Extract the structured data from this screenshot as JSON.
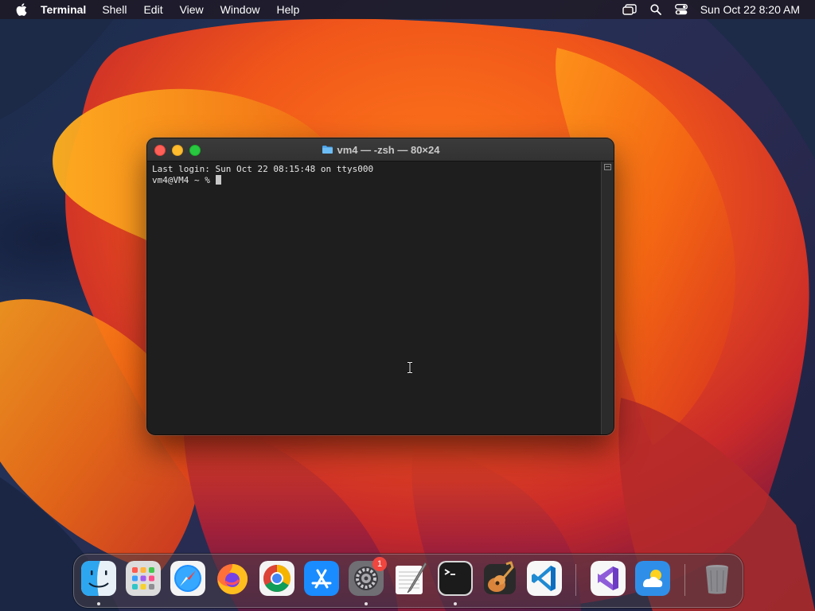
{
  "menubar": {
    "app_name": "Terminal",
    "items": [
      "Shell",
      "Edit",
      "View",
      "Window",
      "Help"
    ],
    "clock": "Sun Oct 22  8:20 AM"
  },
  "window": {
    "title": "vm4 — -zsh — 80×24",
    "lines": [
      "Last login: Sun Oct 22 08:15:48 on ttys000",
      "vm4@VM4 ~ % "
    ]
  },
  "dock": {
    "apps": [
      {
        "name": "Finder",
        "icon": "finder-icon",
        "running": true
      },
      {
        "name": "Launchpad",
        "icon": "launchpad-icon",
        "running": false
      },
      {
        "name": "Safari",
        "icon": "safari-icon",
        "running": false
      },
      {
        "name": "Firefox",
        "icon": "firefox-icon",
        "running": false
      },
      {
        "name": "Google Chrome",
        "icon": "chrome-icon",
        "running": false
      },
      {
        "name": "App Store",
        "icon": "app-store-icon",
        "running": false
      },
      {
        "name": "System Settings",
        "icon": "system-settings-icon",
        "running": true,
        "badge": "1"
      },
      {
        "name": "TextEdit",
        "icon": "textedit-icon",
        "running": false
      },
      {
        "name": "Terminal",
        "icon": "terminal-icon",
        "running": true
      },
      {
        "name": "GarageBand",
        "icon": "garageband-icon",
        "running": false
      },
      {
        "name": "Visual Studio Code",
        "icon": "vscode-icon",
        "running": false
      },
      {
        "name": "Visual Studio",
        "icon": "visual-studio-icon",
        "running": false
      },
      {
        "name": "Weather",
        "icon": "weather-icon",
        "running": false
      },
      {
        "name": "Trash",
        "icon": "trash-icon",
        "running": false
      }
    ]
  }
}
